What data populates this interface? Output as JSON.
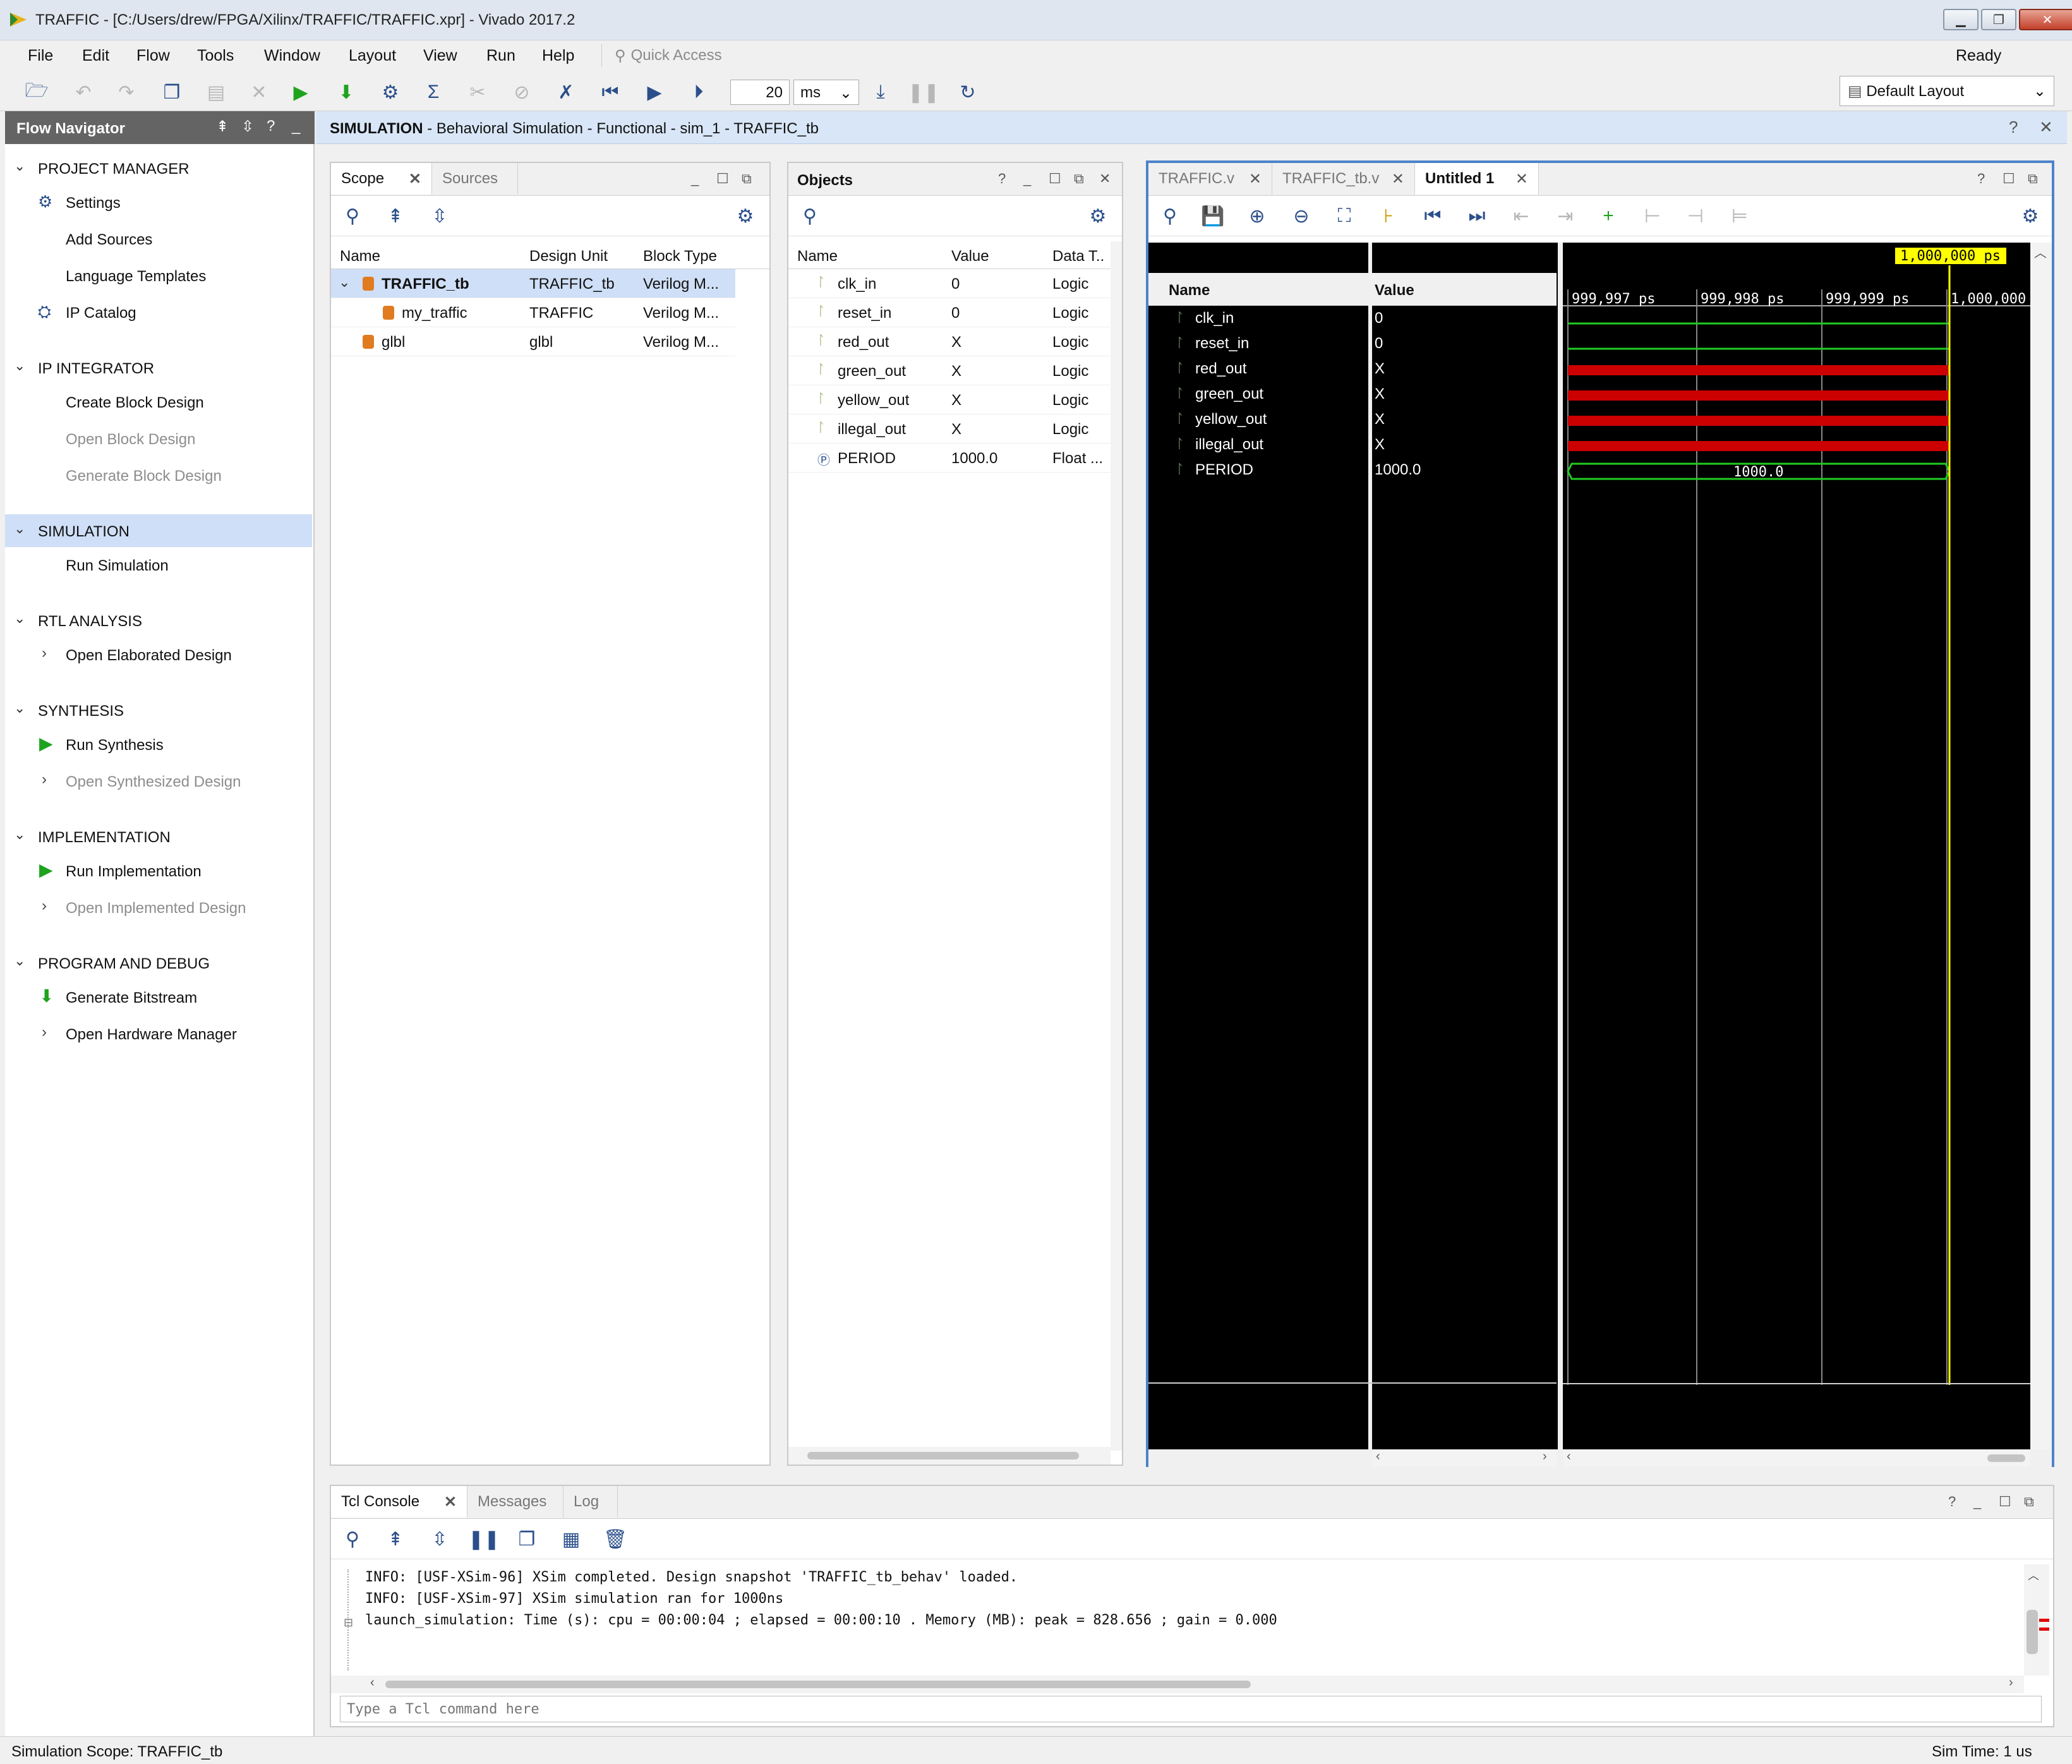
{
  "window": {
    "title": "TRAFFIC - [C:/Users/drew/FPGA/Xilinx/TRAFFIC/TRAFFIC.xpr] - Vivado 2017.2"
  },
  "menu": [
    "File",
    "Edit",
    "Flow",
    "Tools",
    "Window",
    "Layout",
    "View",
    "Run",
    "Help"
  ],
  "quick_access": "Quick Access",
  "status_ready": "Ready",
  "toolbar": {
    "run_time_value": "20",
    "run_time_unit": "ms",
    "layout_select": "Default Layout"
  },
  "flow_nav": {
    "title": "Flow Navigator",
    "sections": [
      {
        "label": "PROJECT MANAGER",
        "items": [
          {
            "label": "Settings",
            "icon": "gear-icon",
            "dim": false
          },
          {
            "label": "Add Sources",
            "icon": "",
            "dim": false
          },
          {
            "label": "Language Templates",
            "icon": "",
            "dim": false
          },
          {
            "label": "IP Catalog",
            "icon": "plug-icon",
            "dim": false
          }
        ]
      },
      {
        "label": "IP INTEGRATOR",
        "items": [
          {
            "label": "Create Block Design",
            "icon": "",
            "dim": false
          },
          {
            "label": "Open Block Design",
            "icon": "",
            "dim": true
          },
          {
            "label": "Generate Block Design",
            "icon": "",
            "dim": true
          }
        ]
      },
      {
        "label": "SIMULATION",
        "items": [
          {
            "label": "Run Simulation",
            "icon": "",
            "dim": false
          }
        ]
      },
      {
        "label": "RTL ANALYSIS",
        "items": [
          {
            "label": "Open Elaborated Design",
            "icon": "chevron-right-icon",
            "dim": false
          }
        ]
      },
      {
        "label": "SYNTHESIS",
        "items": [
          {
            "label": "Run Synthesis",
            "icon": "play-icon",
            "dim": false
          },
          {
            "label": "Open Synthesized Design",
            "icon": "chevron-right-icon",
            "dim": true
          }
        ]
      },
      {
        "label": "IMPLEMENTATION",
        "items": [
          {
            "label": "Run Implementation",
            "icon": "play-icon",
            "dim": false
          },
          {
            "label": "Open Implemented Design",
            "icon": "chevron-right-icon",
            "dim": true
          }
        ]
      },
      {
        "label": "PROGRAM AND DEBUG",
        "items": [
          {
            "label": "Generate Bitstream",
            "icon": "bitstream-icon",
            "dim": false
          },
          {
            "label": "Open Hardware Manager",
            "icon": "chevron-right-icon",
            "dim": false
          }
        ]
      }
    ]
  },
  "sim_header": {
    "bold": "SIMULATION",
    "rest": " - Behavioral Simulation - Functional - sim_1 - TRAFFIC_tb"
  },
  "scope": {
    "tabs": [
      "Scope",
      "Sources"
    ],
    "columns": [
      "Name",
      "Design Unit",
      "Block Type"
    ],
    "rows": [
      {
        "name": "TRAFFIC_tb",
        "unit": "TRAFFIC_tb",
        "type": "Verilog M..."
      },
      {
        "name": "my_traffic",
        "unit": "TRAFFIC",
        "type": "Verilog M..."
      },
      {
        "name": "glbl",
        "unit": "glbl",
        "type": "Verilog M..."
      }
    ]
  },
  "objects": {
    "title": "Objects",
    "columns": [
      "Name",
      "Value",
      "Data T.."
    ],
    "rows": [
      {
        "name": "clk_in",
        "value": "0",
        "type": "Logic"
      },
      {
        "name": "reset_in",
        "value": "0",
        "type": "Logic"
      },
      {
        "name": "red_out",
        "value": "X",
        "type": "Logic"
      },
      {
        "name": "green_out",
        "value": "X",
        "type": "Logic"
      },
      {
        "name": "yellow_out",
        "value": "X",
        "type": "Logic"
      },
      {
        "name": "illegal_out",
        "value": "X",
        "type": "Logic"
      },
      {
        "name": "PERIOD",
        "value": "1000.0",
        "type": "Float ..."
      }
    ]
  },
  "wave": {
    "tabs": [
      "TRAFFIC.v",
      "TRAFFIC_tb.v",
      "Untitled 1"
    ],
    "name_header": "Name",
    "value_header": "Value",
    "cursor_label": "1,000,000 ps",
    "time_labels": [
      "999,997 ps",
      "999,998 ps",
      "999,999 ps",
      "1,000,000"
    ],
    "signals": [
      {
        "name": "clk_in",
        "value": "0",
        "kind": "low"
      },
      {
        "name": "reset_in",
        "value": "0",
        "kind": "low"
      },
      {
        "name": "red_out",
        "value": "X",
        "kind": "x"
      },
      {
        "name": "green_out",
        "value": "X",
        "kind": "x"
      },
      {
        "name": "yellow_out",
        "value": "X",
        "kind": "x"
      },
      {
        "name": "illegal_out",
        "value": "X",
        "kind": "x"
      },
      {
        "name": "PERIOD",
        "value": "1000.0",
        "kind": "bus"
      }
    ],
    "bus_label": "1000.0",
    "colors": {
      "low": "#22cc22",
      "x": "#cc0000",
      "cursor": "#ffff00",
      "bg": "#000000"
    }
  },
  "console": {
    "tabs": [
      "Tcl Console",
      "Messages",
      "Log"
    ],
    "lines": [
      "INFO: [USF-XSim-96] XSim completed. Design snapshot 'TRAFFIC_tb_behav' loaded.",
      "INFO: [USF-XSim-97] XSim simulation ran for 1000ns",
      "launch_simulation: Time (s): cpu = 00:00:04 ; elapsed = 00:00:10 . Memory (MB): peak = 828.656 ; gain = 0.000"
    ],
    "input_placeholder": "Type a Tcl command here"
  },
  "statusbar": {
    "left": "Simulation Scope: TRAFFIC_tb",
    "right": "Sim Time: 1 us"
  }
}
